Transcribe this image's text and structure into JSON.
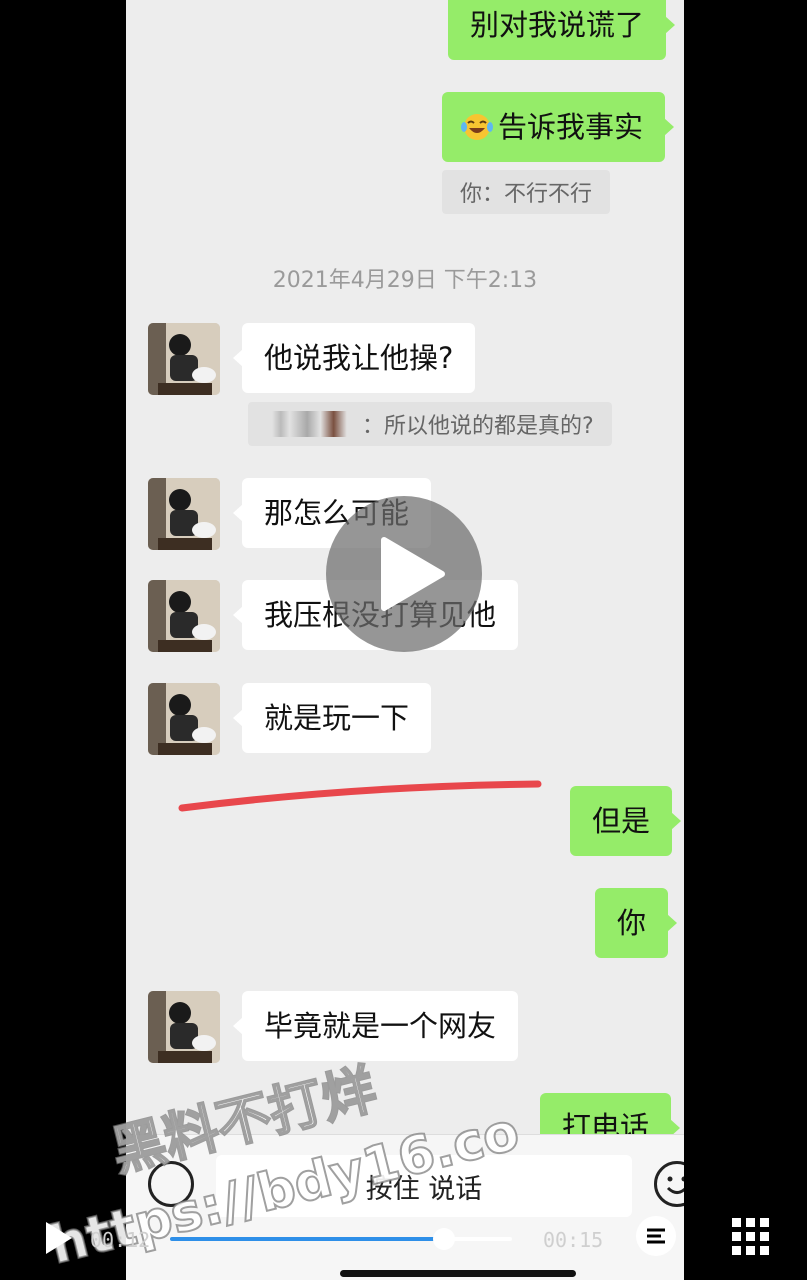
{
  "chat": {
    "messages": [
      {
        "side": "right",
        "text": "别对我说谎了"
      },
      {
        "side": "right",
        "text": "告诉我事实",
        "emoji": "laughing-tears"
      },
      {
        "side": "right",
        "quote": "你：不行不行"
      },
      {
        "timestamp": "2021年4月29日 下午2:13"
      },
      {
        "side": "left",
        "text": "他说我让他操?"
      },
      {
        "side": "left",
        "quote": "：所以他说的都是真的?"
      },
      {
        "side": "left",
        "text": "那怎么可能"
      },
      {
        "side": "left",
        "text": "我压根没打算见他"
      },
      {
        "side": "left",
        "text": "就是玩一下"
      },
      {
        "side": "right",
        "text": "但是"
      },
      {
        "side": "right",
        "text": "你"
      },
      {
        "side": "left",
        "text": "毕竟就是一个网友"
      },
      {
        "side": "right",
        "text": "打电话"
      }
    ],
    "input_bar": {
      "hold_to_talk": "按住 说话"
    }
  },
  "watermark": {
    "line1": "黑料不打烊",
    "line2": "https://bdy16.co"
  },
  "player": {
    "current_time": "00:12",
    "total_time": "00:15",
    "progress": 0.8
  },
  "colors": {
    "bubble_self": "#95ec69",
    "bubble_other": "#ffffff",
    "background": "#ededed",
    "annotation_line": "#e8474c"
  }
}
